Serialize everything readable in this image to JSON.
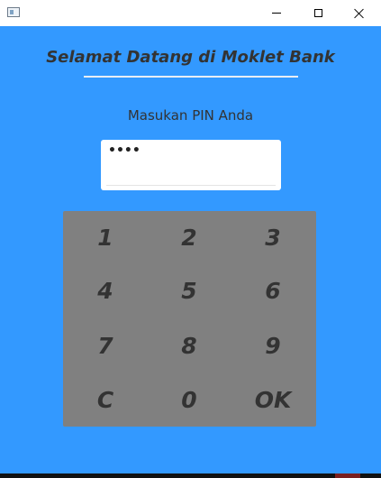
{
  "window": {
    "title": "",
    "controls": [
      "minimize",
      "maximize",
      "close"
    ]
  },
  "heading": "Selamat Datang di Moklet Bank",
  "pin_label": "Masukan PIN Anda",
  "pin_value": "••••",
  "keypad": {
    "keys": [
      "1",
      "2",
      "3",
      "4",
      "5",
      "6",
      "7",
      "8",
      "9",
      "C",
      "0",
      "OK"
    ]
  },
  "colors": {
    "background": "#3399ff",
    "keypad": "#808080",
    "text": "#333333"
  }
}
